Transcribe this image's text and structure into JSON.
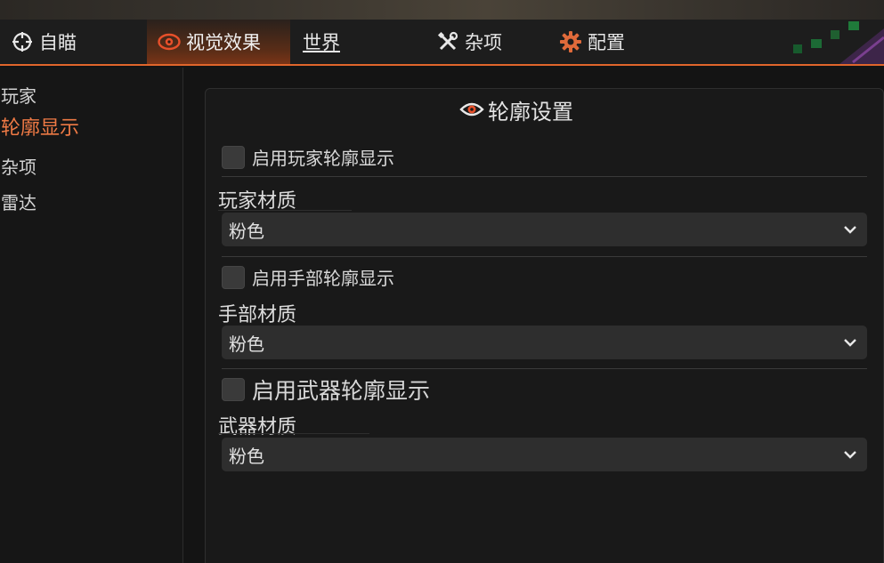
{
  "tabs": [
    {
      "label": "自瞄",
      "icon": "crosshair-icon"
    },
    {
      "label": "视觉效果",
      "icon": "eye-icon",
      "active": true
    },
    {
      "label": "世界",
      "icon": "none"
    },
    {
      "label": "杂项",
      "icon": "tools-icon"
    },
    {
      "label": "配置",
      "icon": "gear-icon"
    }
  ],
  "sidebar": {
    "items": [
      {
        "label": "玩家"
      },
      {
        "label": "轮廓显示",
        "active": true
      },
      {
        "label": "杂项"
      },
      {
        "label": "雷达"
      }
    ]
  },
  "panel": {
    "title": "轮廓设置",
    "title_icon": "eye-icon",
    "player_outline_label": "启用玩家轮廓显示",
    "player_material_label": "玩家材质",
    "player_material_value": "粉色",
    "hand_outline_label": "启用手部轮廓显示",
    "hand_material_label": "手部材质",
    "hand_material_value": "粉色",
    "weapon_outline_label": "启用武器轮廓显示",
    "weapon_material_label": "武器材质",
    "weapon_material_value": "粉色"
  },
  "colors": {
    "accent": "#e0652b",
    "active_text": "#ef7a45",
    "background": "#141414",
    "panel": "#191919",
    "select_bg": "#2e2e2e"
  }
}
